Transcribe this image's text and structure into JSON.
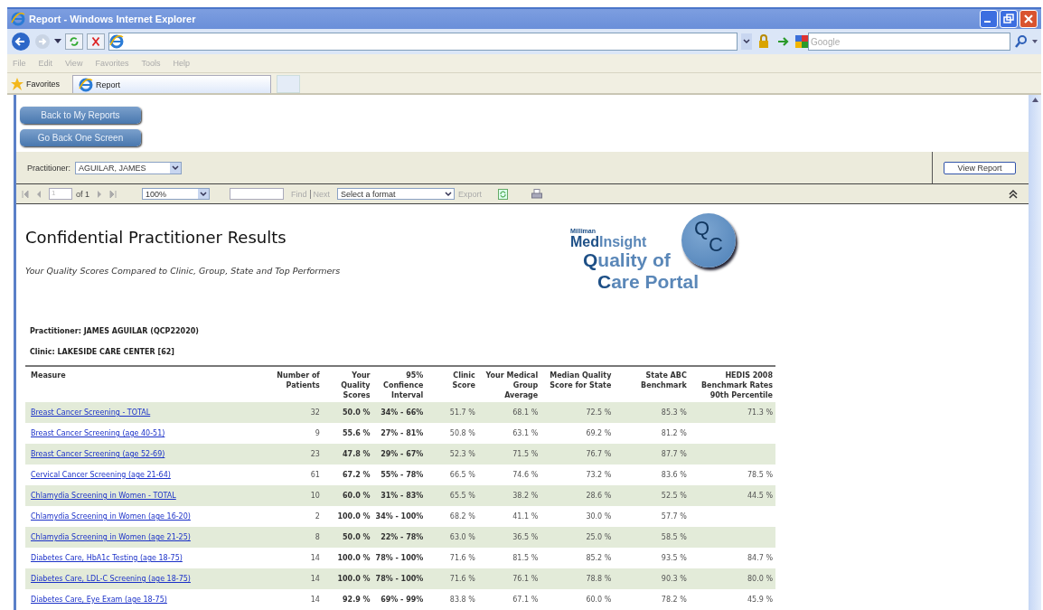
{
  "window": {
    "title": "Report - Windows Internet Explorer"
  },
  "search": {
    "placeholder": "Google"
  },
  "menu": [
    "File",
    "Edit",
    "View",
    "Favorites",
    "Tools",
    "Help"
  ],
  "favorites": {
    "label": "Favorites",
    "tabs": [
      {
        "label": "Report",
        "selected": true
      }
    ]
  },
  "nav_buttons": [
    "Back to My Reports",
    "Go Back One Screen"
  ],
  "parameters": {
    "label": "Practitioner:",
    "value": "AGUILAR, JAMES",
    "button": "View Report"
  },
  "toolbar": {
    "page": "1",
    "page_count": "of 1",
    "zoom": "100%",
    "find": "Find",
    "next": "Next",
    "format": "Select a format",
    "export": "Export"
  },
  "report": {
    "title": "Confidential Practitioner Results",
    "subtitle": "Your Quality Scores Compared to Clinic, Group, State and Top Performers",
    "logo": {
      "brand": "Milliman",
      "name_first": "Med",
      "name_second": "Insight",
      "line_1": "Quality of",
      "line_2": "Care Portal",
      "badge_1": "Q",
      "badge_2": "C"
    },
    "practitioner": "Practitioner: JAMES AGUILAR (QCP22020)",
    "clinic": "Clinic: LAKESIDE CARE CENTER [62]",
    "table": {
      "columns": [
        "Measure",
        "Number of Patients",
        "Your Quality Scores",
        "95% Confience Interval",
        "Clinic Score",
        "Your Medical Group Average",
        "Median Quality Score for State",
        "State ABC Benchmark",
        "HEDIS 2008 Benchmark Rates 90th Percentile"
      ],
      "rows": [
        [
          "Breast Cancer Screening - TOTAL",
          "32",
          "50.0 %",
          "34% - 66%",
          "51.7 %",
          "68.1 %",
          "72.5 %",
          "85.3 %",
          "71.3 %"
        ],
        [
          "Breast Cancer Screening (age 40-51)",
          "9",
          "55.6 %",
          "27% - 81%",
          "50.8 %",
          "63.1 %",
          "69.2 %",
          "81.2 %",
          null
        ],
        [
          "Breast Cancer Screening (age 52-69)",
          "23",
          "47.8 %",
          "29% - 67%",
          "52.3 %",
          "71.5 %",
          "76.7 %",
          "87.7 %",
          null
        ],
        [
          "Cervical Cancer Screening (age 21-64)",
          "61",
          "67.2 %",
          "55% - 78%",
          "66.5 %",
          "74.6 %",
          "73.2 %",
          "83.6 %",
          "78.5 %"
        ],
        [
          "Chlamydia Screening in Women - TOTAL",
          "10",
          "60.0 %",
          "31% - 83%",
          "65.5 %",
          "38.2 %",
          "28.6 %",
          "52.5 %",
          "44.5 %"
        ],
        [
          "Chlamydia Screening in Women (age 16-20)",
          "2",
          "100.0 %",
          "34% - 100%",
          "68.2 %",
          "41.1 %",
          "30.0 %",
          "57.7 %",
          null
        ],
        [
          "Chlamydia Screening in Women (age 21-25)",
          "8",
          "50.0 %",
          "22% - 78%",
          "63.0 %",
          "36.5 %",
          "25.0 %",
          "58.5 %",
          null
        ],
        [
          "Diabetes Care, HbA1c Testing (age 18-75)",
          "14",
          "100.0 %",
          "78% - 100%",
          "71.6 %",
          "81.5 %",
          "85.2 %",
          "93.5 %",
          "84.7 %"
        ],
        [
          "Diabetes Care, LDL-C Screening (age 18-75)",
          "14",
          "100.0 %",
          "78% - 100%",
          "71.6 %",
          "76.1 %",
          "78.8 %",
          "90.3 %",
          "80.0 %"
        ],
        [
          "Diabetes Care, Eye Exam (age 18-75)",
          "14",
          "92.9 %",
          "69% - 99%",
          "83.8 %",
          "67.1 %",
          "60.0 %",
          "78.2 %",
          "45.9 %"
        ]
      ]
    }
  }
}
